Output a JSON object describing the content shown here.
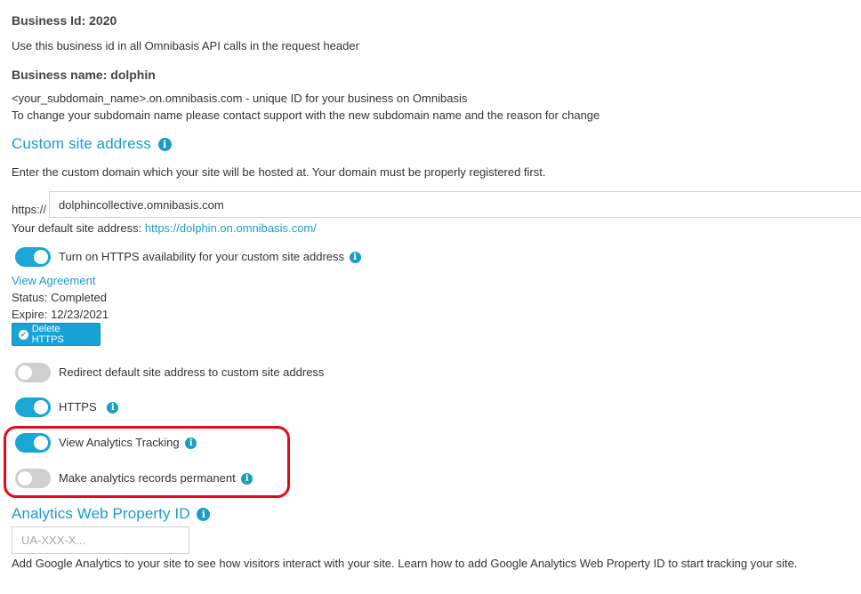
{
  "business_id": {
    "label": "Business Id: 2020",
    "description": "Use this business id in all Omnibasis API calls in the request header"
  },
  "business_name": {
    "label": "Business name: dolphin",
    "line1": "<your_subdomain_name>.on.omnibasis.com - unique ID for your business on Omnibasis",
    "line2": "To change your subdomain name please contact support with the new subdomain name and the reason for change"
  },
  "custom_site": {
    "heading": "Custom site address",
    "description": "Enter the custom domain which your site will be hosted at. Your domain must be properly registered first.",
    "prefix": "https://",
    "domain_value": "dolphincollective.omnibasis.com",
    "default_label": "Your default site address:",
    "default_link": "https://dolphin.on.omnibasis.com/"
  },
  "https_availability": {
    "label": "Turn on HTTPS availability for your custom site address",
    "enabled": true,
    "view_agreement": "View Agreement",
    "status": "Status: Completed",
    "expire": "Expire: 12/23/2021",
    "delete_button": "Delete HTTPS"
  },
  "toggles": [
    {
      "label": "Redirect default site address to custom site address",
      "enabled": false
    },
    {
      "label": "HTTPS",
      "enabled": true
    },
    {
      "label": "View Analytics Tracking",
      "enabled": true
    },
    {
      "label": "Make analytics records permanent",
      "enabled": false
    }
  ],
  "analytics": {
    "heading": "Analytics Web Property ID",
    "placeholder": "UA-XXX-X...",
    "value": "",
    "description": "Add Google Analytics to your site to see how visitors interact with your site. Learn how to add Google Analytics Web Property ID to start tracking your site."
  },
  "colors": {
    "accent": "#1a9cc9",
    "toggle_on": "#1aa6d6",
    "toggle_off": "#cfcfcf",
    "highlight": "#e3091b"
  },
  "icons": {
    "info": "info-circle-icon",
    "check": "check-circle-icon"
  }
}
